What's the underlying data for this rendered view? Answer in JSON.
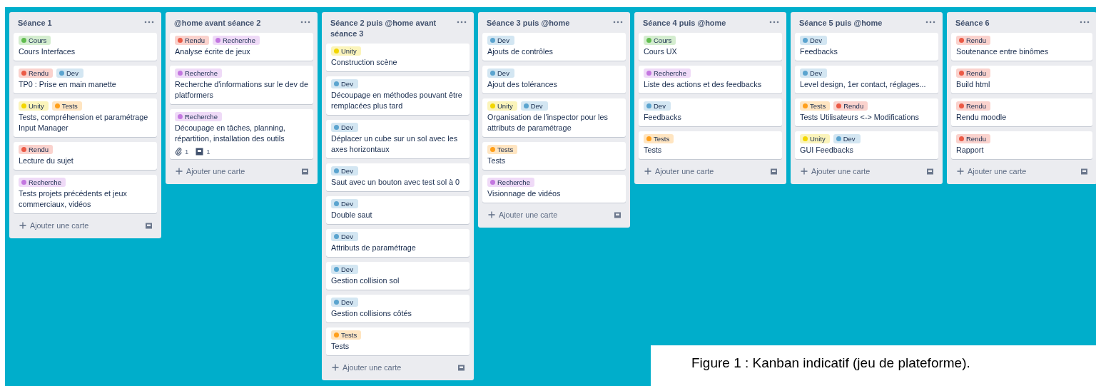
{
  "lists": [
    {
      "title": "Séance 1",
      "add_label": "Ajouter une carte",
      "cards": [
        {
          "labels": [
            {
              "name": "Cours",
              "color": "#61bd4f"
            }
          ],
          "title": "Cours Interfaces"
        },
        {
          "labels": [
            {
              "name": "Rendu",
              "color": "#eb5a46"
            },
            {
              "name": "Dev",
              "color": "#5ba4cf"
            }
          ],
          "title": "TP0 : Prise en main manette"
        },
        {
          "labels": [
            {
              "name": "Unity",
              "color": "#f2d600"
            },
            {
              "name": "Tests",
              "color": "#ff9f1a"
            }
          ],
          "title": "Tests, compréhension et paramétrage Input Manager"
        },
        {
          "labels": [
            {
              "name": "Rendu",
              "color": "#eb5a46"
            }
          ],
          "title": "Lecture du sujet"
        },
        {
          "labels": [
            {
              "name": "Recherche",
              "color": "#c377e0"
            }
          ],
          "title": "Tests projets précédents et jeux commerciaux, vidéos"
        }
      ]
    },
    {
      "title": "@home avant séance 2",
      "add_label": "Ajouter une carte",
      "cards": [
        {
          "labels": [
            {
              "name": "Rendu",
              "color": "#eb5a46"
            },
            {
              "name": "Recherche",
              "color": "#c377e0"
            }
          ],
          "title": "Analyse écrite de jeux"
        },
        {
          "labels": [
            {
              "name": "Recherche",
              "color": "#c377e0"
            }
          ],
          "title": "Recherche d'informations sur le dev de platformers"
        },
        {
          "labels": [
            {
              "name": "Recherche",
              "color": "#c377e0"
            }
          ],
          "title": "Découpage en tâches, planning, répartition, installation des outils",
          "badges": [
            {
              "kind": "attachment",
              "count": "1"
            },
            {
              "kind": "tray",
              "count": "1"
            }
          ]
        }
      ]
    },
    {
      "title": "Séance 2 puis @home avant séance 3",
      "add_label": "Ajouter une carte",
      "cards": [
        {
          "labels": [
            {
              "name": "Unity",
              "color": "#f2d600"
            }
          ],
          "title": "Construction scène"
        },
        {
          "labels": [
            {
              "name": "Dev",
              "color": "#5ba4cf"
            }
          ],
          "title": "Découpage en méthodes pouvant être remplacées plus tard"
        },
        {
          "labels": [
            {
              "name": "Dev",
              "color": "#5ba4cf"
            }
          ],
          "title": "Déplacer un cube sur un sol avec les axes horizontaux"
        },
        {
          "labels": [
            {
              "name": "Dev",
              "color": "#5ba4cf"
            }
          ],
          "title": "Saut avec un bouton avec test sol à 0"
        },
        {
          "labels": [
            {
              "name": "Dev",
              "color": "#5ba4cf"
            }
          ],
          "title": "Double saut"
        },
        {
          "labels": [
            {
              "name": "Dev",
              "color": "#5ba4cf"
            }
          ],
          "title": "Attributs de paramétrage"
        },
        {
          "labels": [
            {
              "name": "Dev",
              "color": "#5ba4cf"
            }
          ],
          "title": "Gestion collision sol"
        },
        {
          "labels": [
            {
              "name": "Dev",
              "color": "#5ba4cf"
            }
          ],
          "title": "Gestion collisions côtés"
        },
        {
          "labels": [
            {
              "name": "Tests",
              "color": "#ff9f1a"
            }
          ],
          "title": "Tests"
        }
      ]
    },
    {
      "title": "Séance 3 puis @home",
      "add_label": "Ajouter une carte",
      "cards": [
        {
          "labels": [
            {
              "name": "Dev",
              "color": "#5ba4cf"
            }
          ],
          "title": "Ajouts de contrôles"
        },
        {
          "labels": [
            {
              "name": "Dev",
              "color": "#5ba4cf"
            }
          ],
          "title": "Ajout des tolérances"
        },
        {
          "labels": [
            {
              "name": "Unity",
              "color": "#f2d600"
            },
            {
              "name": "Dev",
              "color": "#5ba4cf"
            }
          ],
          "title": "Organisation de l'inspector pour les attributs de paramétrage"
        },
        {
          "labels": [
            {
              "name": "Tests",
              "color": "#ff9f1a"
            }
          ],
          "title": "Tests"
        },
        {
          "labels": [
            {
              "name": "Recherche",
              "color": "#c377e0"
            }
          ],
          "title": "Visionnage de vidéos"
        }
      ]
    },
    {
      "title": "Séance 4 puis @home",
      "add_label": "Ajouter une carte",
      "cards": [
        {
          "labels": [
            {
              "name": "Cours",
              "color": "#61bd4f"
            }
          ],
          "title": "Cours UX"
        },
        {
          "labels": [
            {
              "name": "Recherche",
              "color": "#c377e0"
            }
          ],
          "title": "Liste des actions et des feedbacks"
        },
        {
          "labels": [
            {
              "name": "Dev",
              "color": "#5ba4cf"
            }
          ],
          "title": "Feedbacks"
        },
        {
          "labels": [
            {
              "name": "Tests",
              "color": "#ff9f1a"
            }
          ],
          "title": "Tests"
        }
      ]
    },
    {
      "title": "Séance 5 puis @home",
      "add_label": "Ajouter une carte",
      "cards": [
        {
          "labels": [
            {
              "name": "Dev",
              "color": "#5ba4cf"
            }
          ],
          "title": "Feedbacks"
        },
        {
          "labels": [
            {
              "name": "Dev",
              "color": "#5ba4cf"
            }
          ],
          "title": "Level design, 1er contact, réglages..."
        },
        {
          "labels": [
            {
              "name": "Tests",
              "color": "#ff9f1a"
            },
            {
              "name": "Rendu",
              "color": "#eb5a46"
            }
          ],
          "title": "Tests Utilisateurs <-> Modifications"
        },
        {
          "labels": [
            {
              "name": "Unity",
              "color": "#f2d600"
            },
            {
              "name": "Dev",
              "color": "#5ba4cf"
            }
          ],
          "title": "GUI Feedbacks"
        }
      ]
    },
    {
      "title": "Séance 6",
      "add_label": "Ajouter une carte",
      "cards": [
        {
          "labels": [
            {
              "name": "Rendu",
              "color": "#eb5a46"
            }
          ],
          "title": "Soutenance entre binômes"
        },
        {
          "labels": [
            {
              "name": "Rendu",
              "color": "#eb5a46"
            }
          ],
          "title": "Build html"
        },
        {
          "labels": [
            {
              "name": "Rendu",
              "color": "#eb5a46"
            }
          ],
          "title": "Rendu moodle"
        },
        {
          "labels": [
            {
              "name": "Rendu",
              "color": "#eb5a46"
            }
          ],
          "title": "Rapport"
        }
      ]
    }
  ],
  "caption": "Figure 1 : Kanban indicatif (jeu de plateforme)."
}
